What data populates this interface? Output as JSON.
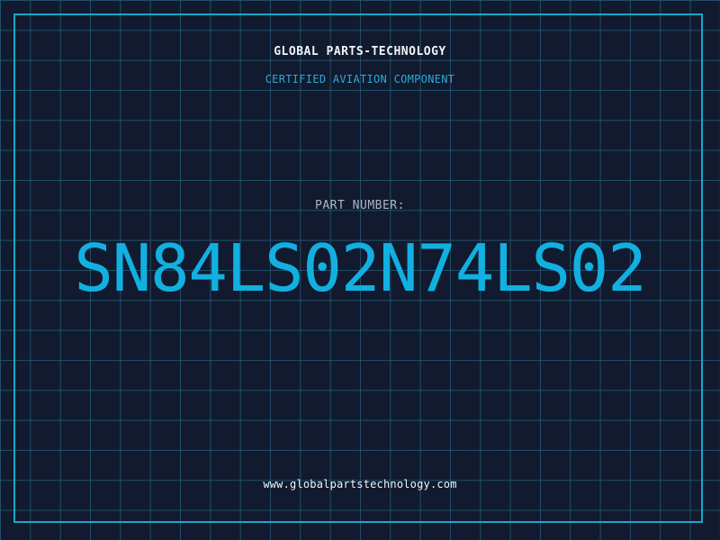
{
  "label": {
    "company": "GLOBAL PARTS-TECHNOLOGY",
    "subtitle": "CERTIFIED AVIATION COMPONENT",
    "part_label": "PART NUMBER:",
    "part_number": "SN84LS02N74LS02",
    "website": "www.globalpartstechnology.com"
  },
  "colors": {
    "background": "#111a2e",
    "grid": "#245876",
    "frame": "#1aa6c9",
    "accent": "#12b0e0",
    "text": "#f2f4f8",
    "muted_text": "#aeb6c2"
  }
}
